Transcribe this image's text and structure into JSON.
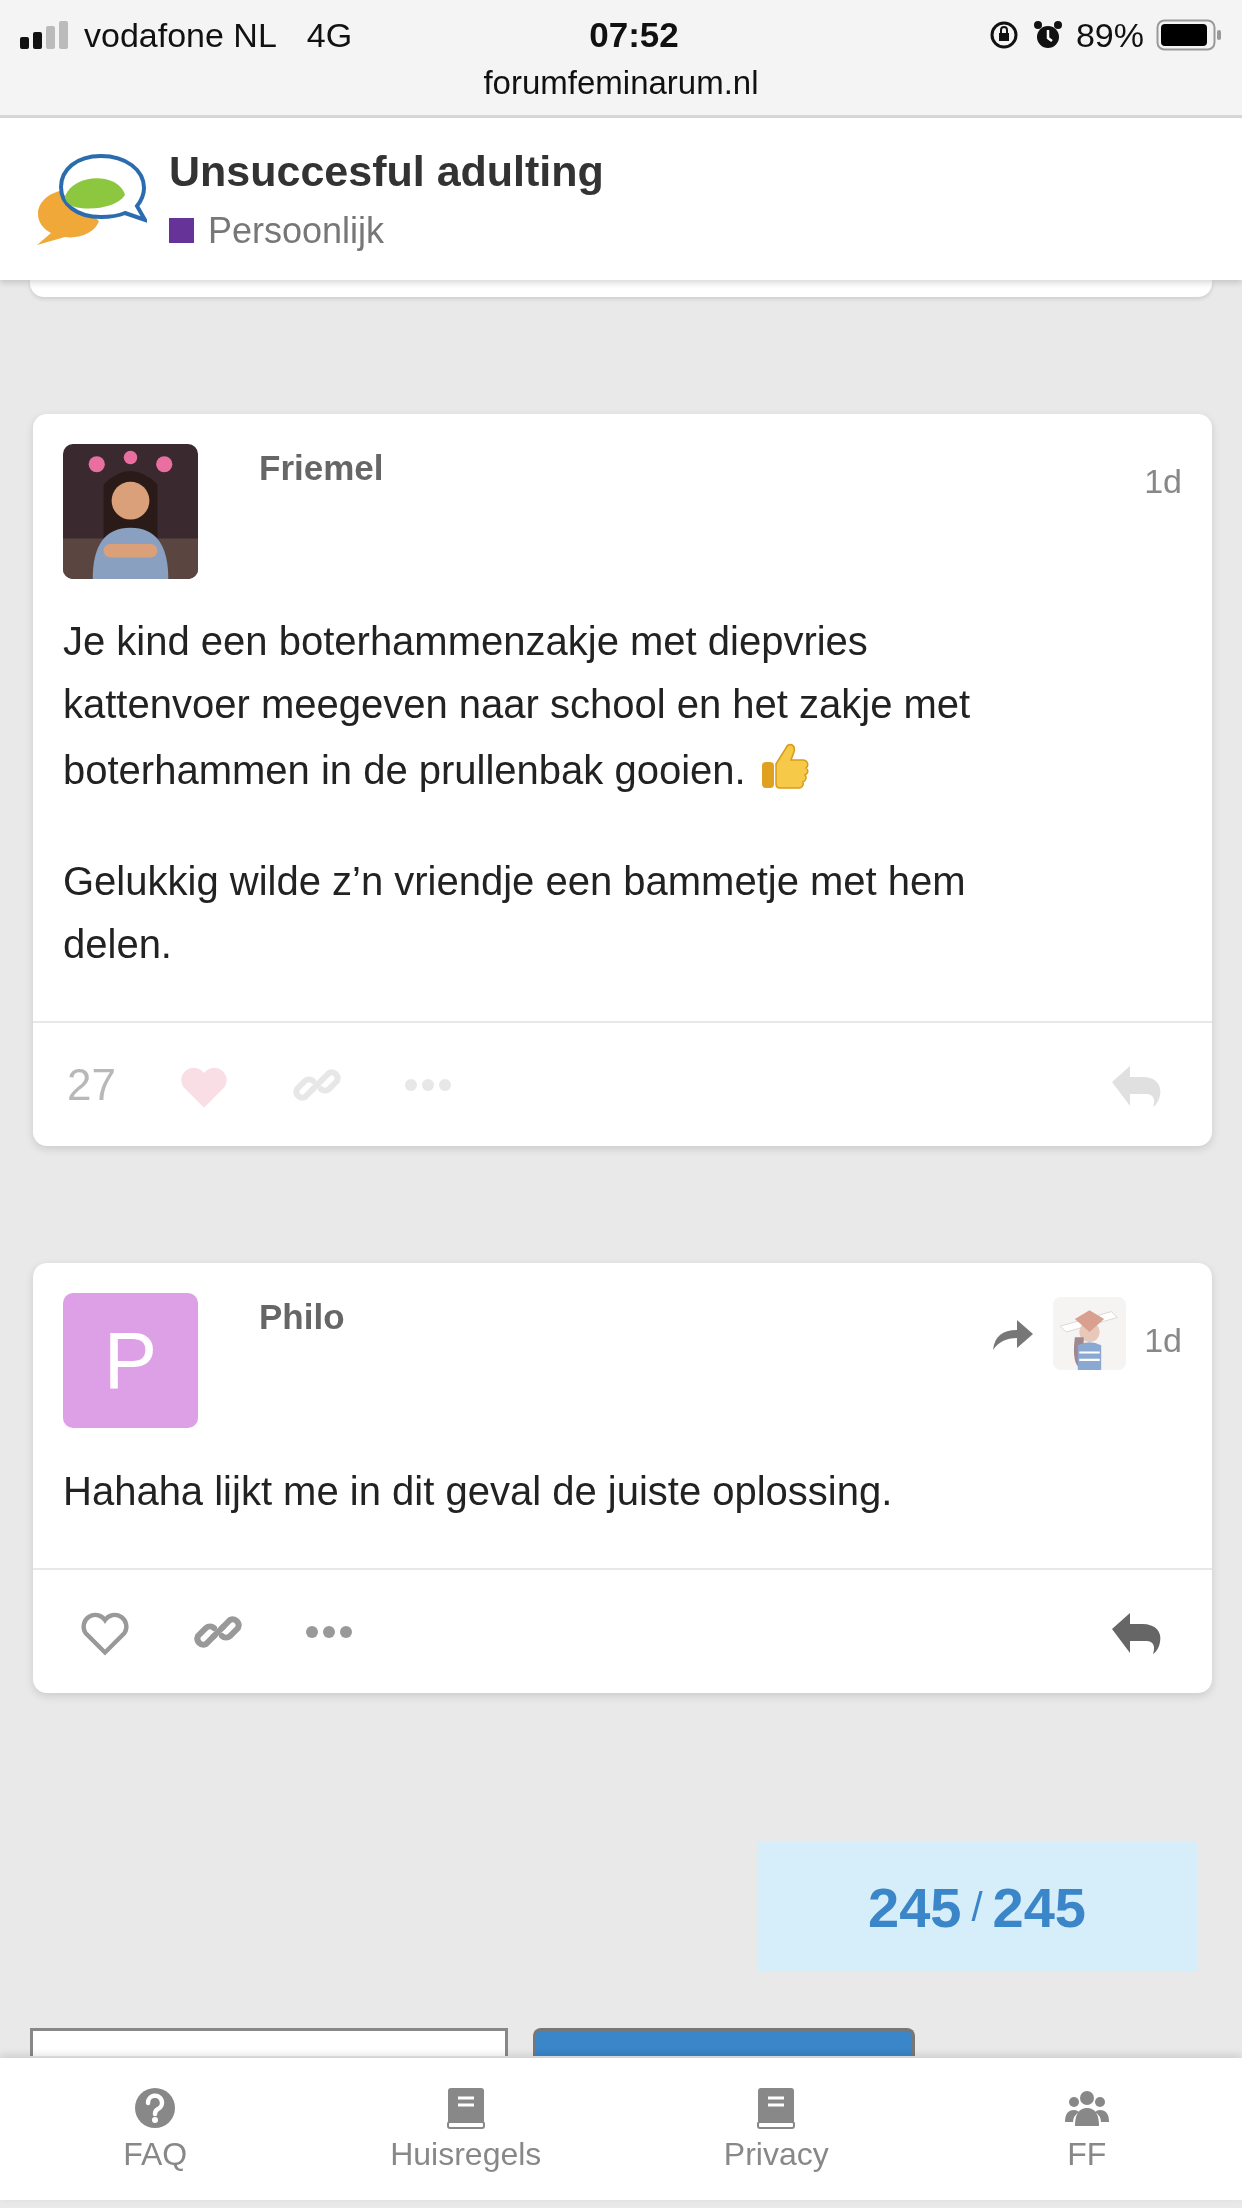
{
  "status_bar": {
    "carrier": "vodafone NL",
    "network": "4G",
    "time": "07:52",
    "battery": "89%"
  },
  "address_bar": {
    "url": "forumfeminarum.nl"
  },
  "topic": {
    "title": "Unsuccesful adulting",
    "category": {
      "name": "Persoonlijk",
      "color": "#663399"
    }
  },
  "posts": [
    {
      "author": "Friemel",
      "avatar": {
        "kind": "picture"
      },
      "age": "1d",
      "paragraphs": [
        {
          "text": "Je kind een boterhammenzakje met diepvries kattenvoer meegeven naar school en het zakje met boterhammen in de prullenbak gooien.",
          "has_emoji": true
        },
        {
          "text": "Gelukkig wilde z’n vriendje een bammetje met hem delen.",
          "has_emoji": false
        }
      ],
      "like_count": "27",
      "liked": true,
      "dimmed": true
    },
    {
      "author": "Philo",
      "avatar": {
        "kind": "letter",
        "letter": "P",
        "color": "#dda0e6"
      },
      "age": "1d",
      "reply_to": {
        "kind": "picture"
      },
      "paragraphs": [
        {
          "text": "Hahaha lijkt me in dit geval de juiste oplossing.",
          "has_emoji": false
        }
      ],
      "liked": false,
      "dimmed": false
    }
  ],
  "progress": {
    "current": "245",
    "separator": "/",
    "total": "245"
  },
  "footer_nav": [
    {
      "label": "FAQ",
      "kind": "question"
    },
    {
      "label": "Huisregels",
      "kind": "book"
    },
    {
      "label": "Privacy",
      "kind": "book"
    },
    {
      "label": "FF",
      "kind": "people"
    }
  ]
}
